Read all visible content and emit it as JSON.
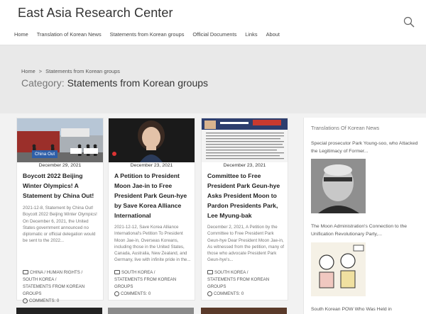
{
  "site": {
    "title": "East Asia Research Center"
  },
  "nav": {
    "items": [
      "Home",
      "Translation of Korean News",
      "Statements from Korean groups",
      "Official Documents",
      "Links",
      "About"
    ]
  },
  "breadcrumb": {
    "home": "Home",
    "sep": ">",
    "current": "Statements from Korean groups"
  },
  "category": {
    "label": "Category:",
    "name": "Statements from Korean groups"
  },
  "cards": [
    {
      "date": "December 29, 2021",
      "title": "Boycott 2022 Beijing Winter Olympics! A Statement by China Out!",
      "excerpt": "2021-12-8, Statement by China Out! Boycott 2022 Beijing Winter Olympics! On December 6, 2021, the United States government announced no diplomatic or official delegation would be sent to the 2022...",
      "cat_line1": "CHINA / HUMAN RIGHTS /",
      "cat_line2": "SOUTH KOREA /",
      "cat_line3": "STATEMENTS FROM KOREAN GROUPS",
      "comments": "COMMENTS: 0",
      "sign_text": "China Out"
    },
    {
      "date": "December 23, 2021",
      "title": "A Petition to President Moon Jae-in to Free President Park Geun-hye by Save Korea Alliance International",
      "excerpt": "2021-12-12, Save Korea Alliance International's Petition To President Moon Jae-in, Overseas Koreans, including those in the United States, Canada, Australia, New Zealand, and Germany, live with infinite pride in the...",
      "cat_line1": "SOUTH KOREA /",
      "cat_line2": "STATEMENTS FROM KOREAN GROUPS",
      "comments": "COMMENTS: 0"
    },
    {
      "date": "December 23, 2021",
      "title": "Committee to Free President Park Geun-hye Asks President Moon to Pardon Presidents Park, Lee Myung-bak",
      "excerpt": "December 2, 2021, A Petition by the Committee to Free President Park Geun-hye Dear President Moon Jae-in, As witnessed from the petition, many of those who advocate President Park Geun-hye's...",
      "cat_line1": "SOUTH KOREA /",
      "cat_line2": "STATEMENTS FROM KOREAN GROUPS",
      "comments": "COMMENTS: 0"
    }
  ],
  "sidebar": {
    "title": "Translations Of Korean News",
    "items": [
      {
        "title": "Special prosecutor Park Young-soo, who Attacked the Legitimacy of Former..."
      },
      {
        "title": "The Moon Administration's Connection to the Unification Revolutionary Party,..."
      },
      {
        "title": "South Korean POW Who Was Held in"
      }
    ]
  },
  "colors": {
    "accent": "#222222",
    "bg": "#efefef"
  }
}
